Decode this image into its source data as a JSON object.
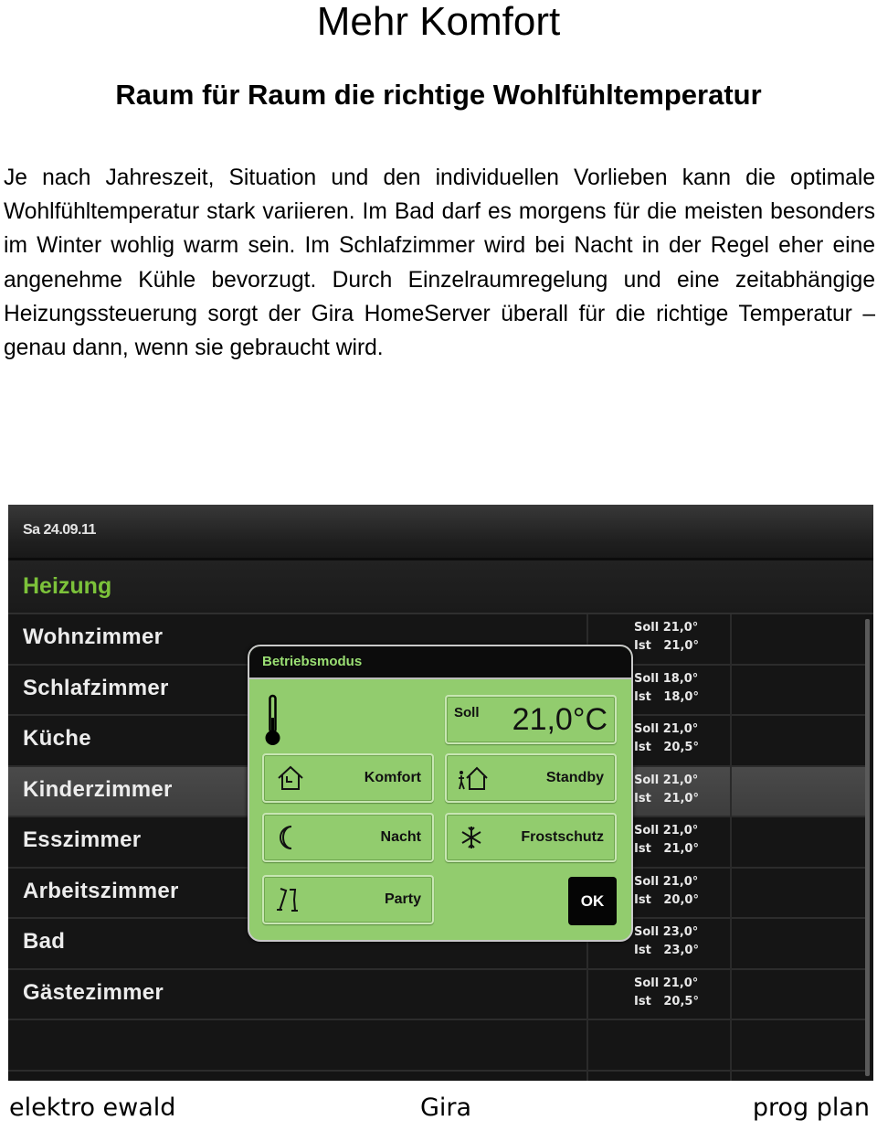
{
  "document": {
    "title": "Mehr Komfort",
    "subtitle": "Raum für Raum die richtige Wohlfühltemperatur",
    "body": "Je nach Jahreszeit, Situation und den individuellen Vorlieben kann die optimale Wohlfühltemperatur stark variieren. Im Bad darf es morgens für die meisten besonders im Winter wohlig warm sein. Im Schlafzimmer wird bei Nacht in der Regel eher eine angenehme Kühle bevorzugt. Durch Einzelraumregelung und eine zeitabhängige Heizungssteuerung sorgt der Gira HomeServer überall für die richtige Temperatur – genau dann, wenn sie gebraucht wird."
  },
  "screen": {
    "date": "Sa 24.09.11",
    "section": "Heizung",
    "accent_color": "#7cc23a",
    "rooms": [
      {
        "name": "Wohnzimmer",
        "soll": "Soll 21,0°",
        "ist": "Ist   21,0°",
        "selected": false
      },
      {
        "name": "Schlafzimmer",
        "soll": "Soll 18,0°",
        "ist": "Ist   18,0°",
        "selected": false
      },
      {
        "name": "Küche",
        "soll": "Soll 21,0°",
        "ist": "Ist   20,5°",
        "selected": false
      },
      {
        "name": "Kinderzimmer",
        "soll": "Soll 21,0°",
        "ist": "Ist   21,0°",
        "selected": true
      },
      {
        "name": "Esszimmer",
        "soll": "Soll 21,0°",
        "ist": "Ist   21,0°",
        "selected": false
      },
      {
        "name": "Arbeitszimmer",
        "soll": "Soll 21,0°",
        "ist": "Ist   20,0°",
        "selected": false
      },
      {
        "name": "Bad",
        "soll": "Soll 23,0°",
        "ist": "Ist   23,0°",
        "selected": false
      },
      {
        "name": "Gästezimmer",
        "soll": "Soll 21,0°",
        "ist": "Ist   20,5°",
        "selected": false
      },
      {
        "name": "",
        "soll": "",
        "ist": "",
        "selected": false
      }
    ],
    "dialog": {
      "title": "Betriebsmodus",
      "soll_label": "Soll",
      "soll_value": "21,0°C",
      "modes": {
        "komfort": {
          "label": "Komfort",
          "icon": "house-clock-icon"
        },
        "standby": {
          "label": "Standby",
          "icon": "person-house-icon"
        },
        "nacht": {
          "label": "Nacht",
          "icon": "moon-icon"
        },
        "frostschutz": {
          "label": "Frostschutz",
          "icon": "snowflake-icon"
        },
        "party": {
          "label": "Party",
          "icon": "champagne-glasses-icon"
        }
      },
      "ok_label": "OK",
      "color": "#92cc6e"
    }
  },
  "footer": {
    "left": "elektro ewald",
    "center": "Gira",
    "right": "prog plan"
  }
}
